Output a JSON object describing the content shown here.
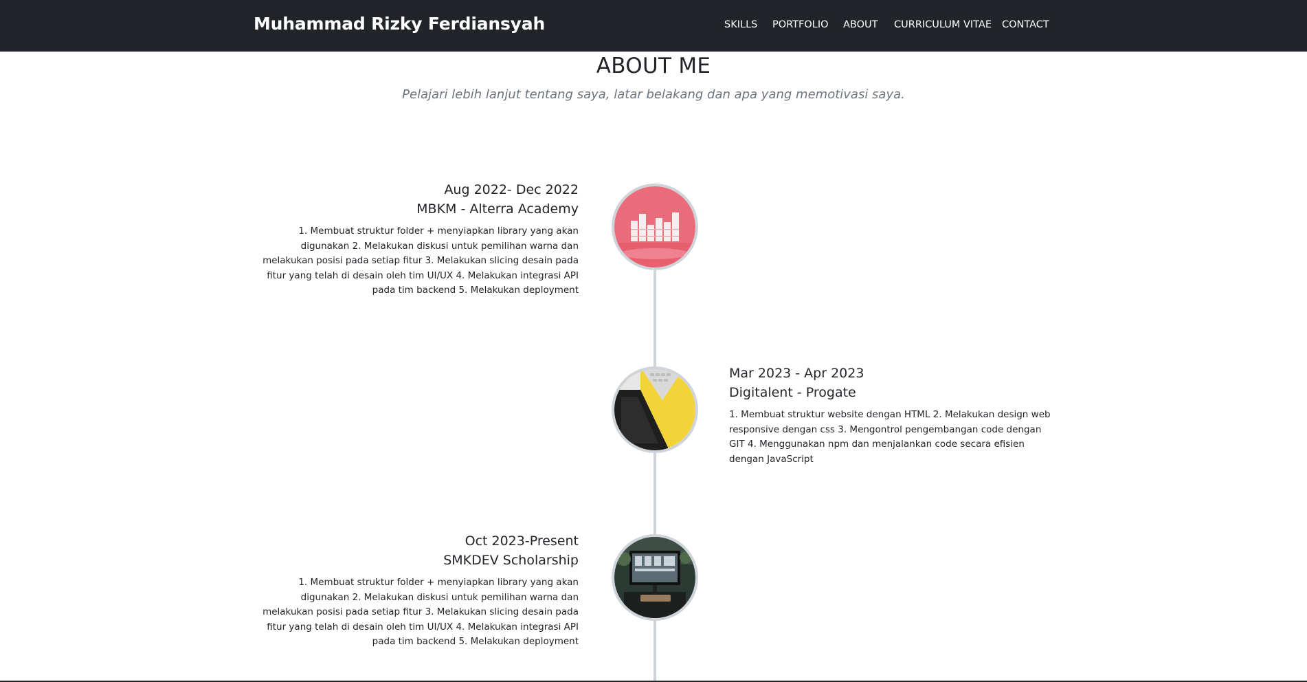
{
  "navbar": {
    "brand": "Muhammad Rizky Ferdiansyah",
    "links": [
      "SKILLS",
      "PORTFOLIO",
      "ABOUT",
      "CURRICULUM VITAE",
      "CONTACT"
    ]
  },
  "about": {
    "title": "ABOUT ME",
    "subtitle": "Pelajari lebih lanjut tentang saya, latar belakang dan apa yang memotivasi saya."
  },
  "timeline": [
    {
      "date": "Aug 2022- Dec 2022",
      "organization": "MBKM - Alterra Academy",
      "description": "1. Membuat struktur folder + menyiapkan library yang akan digunakan 2. Melakukan diskusi untuk pemilihan warna dan melakukan posisi pada setiap fitur 3. Melakukan slicing desain pada fitur yang telah di desain oleh tim UI/UX 4. Melakukan integrasi API pada tim backend 5. Melakukan deployment",
      "image": "pink-blocks-image"
    },
    {
      "date": "Mar 2023 - Apr 2023",
      "organization": "Digitalent - Progate",
      "description": "1. Membuat struktur website dengan HTML 2. Melakukan design web responsive dengan css 3. Mengontrol pengembangan code dengan GIT 4. Menggunakan npm dan menjalankan code secara efisien dengan JavaScript",
      "image": "yellow-laptop-image"
    },
    {
      "date": "Oct 2023-Present",
      "organization": "SMKDEV Scholarship",
      "description": "1. Membuat struktur folder + menyiapkan library yang akan digunakan 2. Melakukan diskusi untuk pemilihan warna dan melakukan posisi pada setiap fitur 3. Melakukan slicing desain pada fitur yang telah di desain oleh tim UI/UX 4. Melakukan integrasi API pada tim backend 5. Melakukan deployment",
      "image": "desk-setup-image"
    }
  ],
  "colors": {
    "navbar_bg": "#212529",
    "text": "#212529",
    "muted": "#6c757d",
    "timeline_line": "#ced4da"
  }
}
